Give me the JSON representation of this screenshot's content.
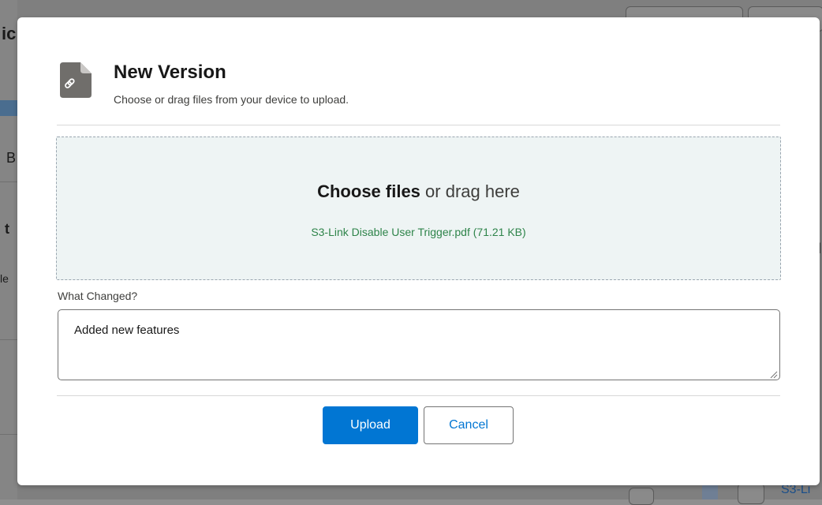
{
  "background": {
    "left_fragments": [
      "ic",
      "B",
      "t",
      "le"
    ],
    "right_link_fragment": "S3-Li",
    "right_letter": "l"
  },
  "modal": {
    "icon": "attachment-document-icon",
    "title": "New Version",
    "subtitle": "Choose or drag files from your device to upload.",
    "dropzone": {
      "choose_label": "Choose files",
      "drag_label": " or drag here",
      "selected_file": "S3-Link Disable User Trigger.pdf (71.21 KB)"
    },
    "what_changed": {
      "label": "What Changed?",
      "value": "Added new features"
    },
    "buttons": {
      "upload": "Upload",
      "cancel": "Cancel"
    }
  },
  "colors": {
    "brand": "#0176d3",
    "success_text": "#2e844a",
    "dropzone_bg": "#eef4f4",
    "icon_gray": "#706e6b"
  }
}
